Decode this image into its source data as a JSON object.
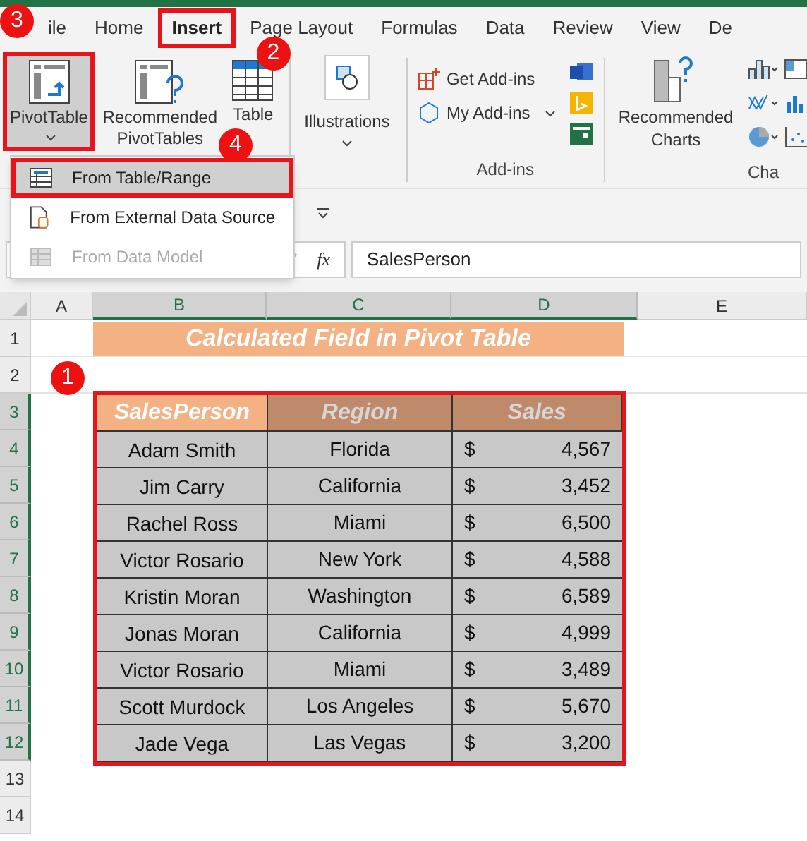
{
  "tabs": [
    {
      "label": "ile",
      "selected": false,
      "highlighted": false,
      "callout": "3"
    },
    {
      "label": "Home",
      "selected": false,
      "highlighted": false
    },
    {
      "label": "Insert",
      "selected": true,
      "highlighted": true,
      "callout": "2"
    },
    {
      "label": "Page Layout",
      "selected": false,
      "highlighted": false
    },
    {
      "label": "Formulas",
      "selected": false,
      "highlighted": false
    },
    {
      "label": "Data",
      "selected": false,
      "highlighted": false
    },
    {
      "label": "Review",
      "selected": false,
      "highlighted": false
    },
    {
      "label": "View",
      "selected": false,
      "highlighted": false
    },
    {
      "label": "De",
      "selected": false,
      "highlighted": false
    }
  ],
  "tables_group": [
    {
      "kind": "pivot",
      "label": "PivotTable",
      "highlighted": true
    },
    {
      "kind": "recommended",
      "label": "Recommended PivotTables",
      "highlighted": false
    },
    {
      "kind": "table",
      "label": "Table",
      "highlighted": false
    }
  ],
  "illustrations": {
    "label": "Illustrations"
  },
  "addins": {
    "label": "Add-ins",
    "items": [
      {
        "kind": "get",
        "label": "Get Add-ins"
      },
      {
        "kind": "my",
        "label": "My Add-ins"
      }
    ]
  },
  "charts": {
    "recommended": "Recommended Charts",
    "label": "Cha"
  },
  "pivot_menu": [
    {
      "label": "From Table/Range",
      "disabled": false,
      "highlighted": true,
      "callout": "4"
    },
    {
      "label": "From External Data Source",
      "disabled": false,
      "highlighted": false
    },
    {
      "label": "From Data Model",
      "disabled": true,
      "highlighted": false
    }
  ],
  "formula_bar": {
    "fx": "fx",
    "value": "SalesPerson"
  },
  "columns": [
    {
      "label": "A",
      "selected": false
    },
    {
      "label": "B",
      "selected": true
    },
    {
      "label": "C",
      "selected": true
    },
    {
      "label": "D",
      "selected": true
    },
    {
      "label": "E",
      "selected": false
    }
  ],
  "row_headers": [
    {
      "label": "1",
      "selected": false
    },
    {
      "label": "2",
      "selected": false
    },
    {
      "label": "3",
      "selected": true
    },
    {
      "label": "4",
      "selected": true
    },
    {
      "label": "5",
      "selected": true
    },
    {
      "label": "6",
      "selected": true
    },
    {
      "label": "7",
      "selected": true
    },
    {
      "label": "8",
      "selected": true
    },
    {
      "label": "9",
      "selected": true
    },
    {
      "label": "10",
      "selected": true
    },
    {
      "label": "11",
      "selected": true
    },
    {
      "label": "12",
      "selected": true
    },
    {
      "label": "13",
      "selected": false
    },
    {
      "label": "14",
      "selected": false
    }
  ],
  "title": "Calculated Field in Pivot Table",
  "table": {
    "callout": "1",
    "highlighted": true,
    "columns": [
      {
        "label": "SalesPerson",
        "kind": "active"
      },
      {
        "label": "Region",
        "kind": "normal"
      },
      {
        "label": "Sales",
        "kind": "normal"
      }
    ],
    "rows": [
      {
        "name": "Adam Smith",
        "region": "Florida",
        "currency": "$",
        "amount": "4,567"
      },
      {
        "name": "Jim Carry",
        "region": "California",
        "currency": "$",
        "amount": "3,452"
      },
      {
        "name": "Rachel Ross",
        "region": "Miami",
        "currency": "$",
        "amount": "6,500"
      },
      {
        "name": "Victor Rosario",
        "region": "New York",
        "currency": "$",
        "amount": "4,588"
      },
      {
        "name": "Kristin Moran",
        "region": "Washington",
        "currency": "$",
        "amount": "6,589"
      },
      {
        "name": "Jonas Moran",
        "region": "California",
        "currency": "$",
        "amount": "4,999"
      },
      {
        "name": "Victor Rosario",
        "region": "Miami",
        "currency": "$",
        "amount": "3,489"
      },
      {
        "name": "Scott Murdock",
        "region": "Los Angeles",
        "currency": "$",
        "amount": "5,670"
      },
      {
        "name": "Jade Vega",
        "region": "Las Vegas",
        "currency": "$",
        "amount": "3,200"
      }
    ]
  }
}
